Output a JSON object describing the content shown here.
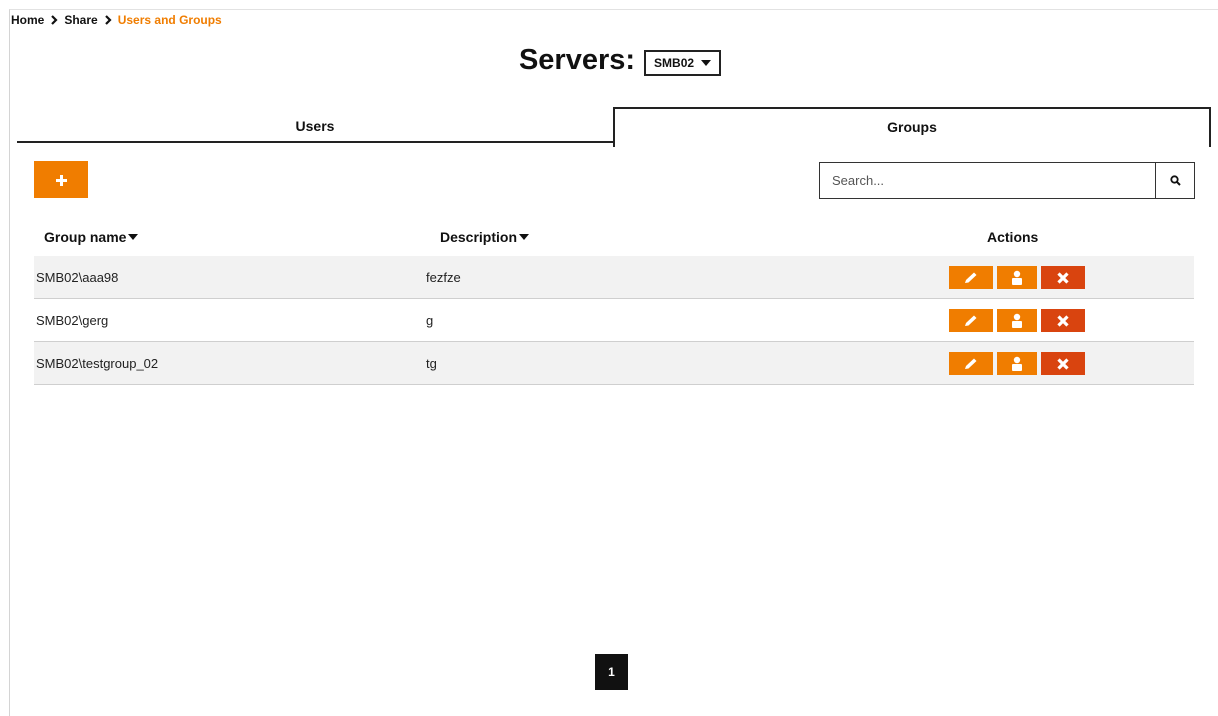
{
  "breadcrumb": {
    "items": [
      "Home",
      "Share"
    ],
    "current": "Users and Groups"
  },
  "servers": {
    "label": "Servers:",
    "selected": "SMB02"
  },
  "tabs": [
    {
      "label": "Users",
      "active": false
    },
    {
      "label": "Groups",
      "active": true
    }
  ],
  "search": {
    "placeholder": "Search..."
  },
  "table": {
    "columns": [
      "Group name",
      "Description",
      "Actions"
    ],
    "rows": [
      {
        "name": "SMB02\\aaa98",
        "description": "fezfze"
      },
      {
        "name": "SMB02\\gerg",
        "description": "g"
      },
      {
        "name": "SMB02\\testgroup_02",
        "description": "tg"
      }
    ]
  },
  "pagination": {
    "current": "1"
  },
  "colors": {
    "accent": "#f07d00",
    "danger": "#d9440f",
    "dark": "#111111"
  },
  "icons": {
    "add": "plus-icon",
    "search": "search-icon",
    "edit": "pencil-icon",
    "members": "user-icon",
    "delete": "close-icon"
  }
}
